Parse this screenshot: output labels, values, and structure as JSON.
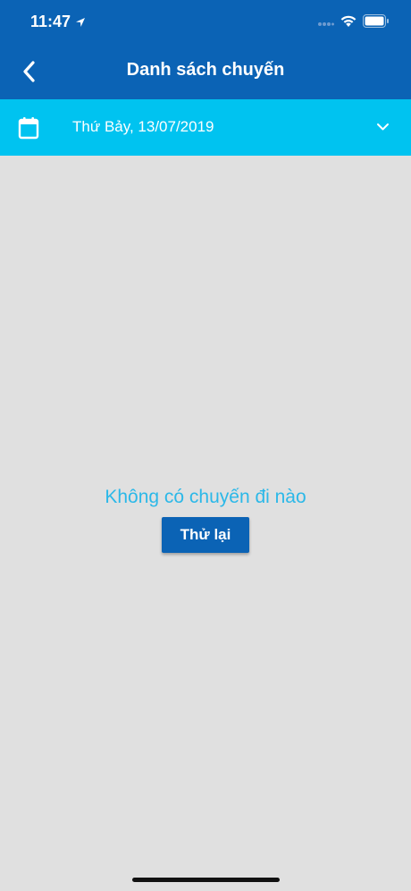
{
  "status_bar": {
    "time": "11:47"
  },
  "header": {
    "title": "Danh sách chuyến"
  },
  "date_selector": {
    "label": "Thứ Bảy, 13/07/2019"
  },
  "empty_state": {
    "message": "Không có chuyến đi nào",
    "retry_label": "Thử lại"
  },
  "colors": {
    "header_bg": "#0b63b5",
    "date_bar_bg": "#00c3f0",
    "content_bg": "#e0e0e0",
    "message_text": "#2bb8e8",
    "button_bg": "#0b63b5"
  },
  "icons": [
    "location-arrow-icon",
    "signal-icon",
    "wifi-icon",
    "battery-icon",
    "back-chevron-icon",
    "calendar-icon",
    "chevron-down-icon"
  ]
}
